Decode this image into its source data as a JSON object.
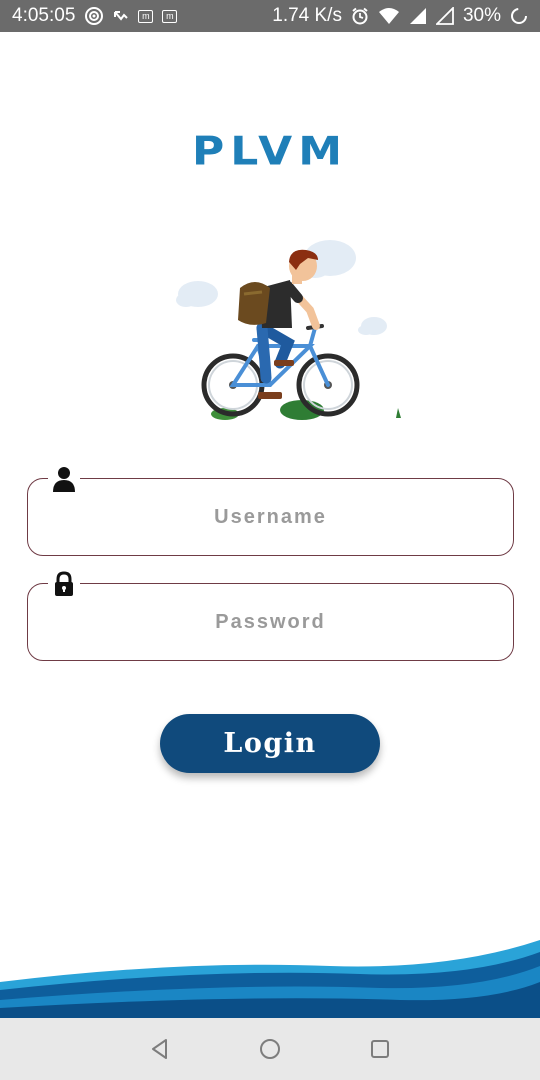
{
  "status_bar": {
    "time": "4:05:05",
    "network_speed": "1.74 K/s",
    "battery": "30%",
    "icons": [
      "target-icon",
      "missed-call-icon",
      "m-app-icon",
      "m-app-icon",
      "alarm-icon",
      "wifi-icon",
      "signal-icon",
      "signal-icon",
      "battery-loading-icon"
    ]
  },
  "app": {
    "logo": "PLVM",
    "brand_color": "#1f7fb8",
    "accent_color": "#104a7c"
  },
  "login_form": {
    "username_placeholder": "Username",
    "password_placeholder": "Password",
    "login_label": "Login"
  },
  "nav_bar": {
    "icons": [
      "back-icon",
      "home-icon",
      "recents-icon"
    ]
  }
}
